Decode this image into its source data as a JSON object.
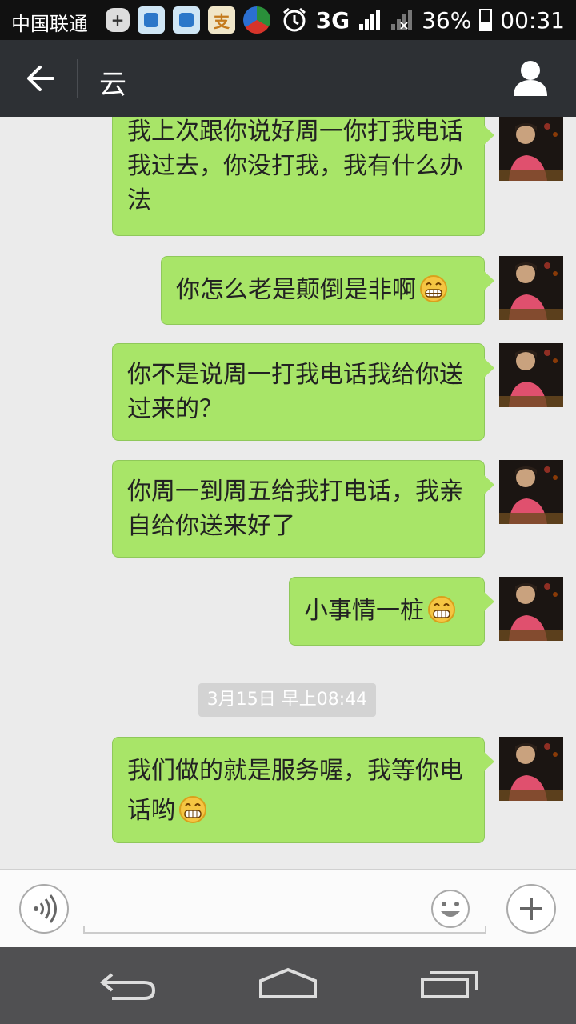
{
  "status_bar": {
    "carrier": "中国联通",
    "network": "3G",
    "battery": "36%",
    "time": "00:31"
  },
  "header": {
    "title": "云"
  },
  "messages": [
    {
      "text": "我上次跟你说好周一你打我电话我过去，你没打我，我有什么办法",
      "emoji": false
    },
    {
      "text": "你怎么老是颠倒是非啊",
      "emoji": true
    },
    {
      "text": "你不是说周一打我电话我给你送过来的？",
      "emoji": false
    },
    {
      "text": "你周一到周五给我打电话，我亲自给你送来好了",
      "emoji": false
    },
    {
      "text": "小事情一桩",
      "emoji": true
    },
    {
      "text": "我们做的就是服务喔，我等你电话哟",
      "emoji": true
    }
  ],
  "timestamp": "3月15日 早上08:44",
  "input": {
    "placeholder": ""
  },
  "colors": {
    "bubble": "#a8e568",
    "header": "#2d3034",
    "background": "#ebebeb"
  },
  "icons": {
    "back": "back-arrow-icon",
    "profile": "person-icon",
    "voice": "voice-icon",
    "emoji": "smiley-icon",
    "add": "plus-icon"
  }
}
